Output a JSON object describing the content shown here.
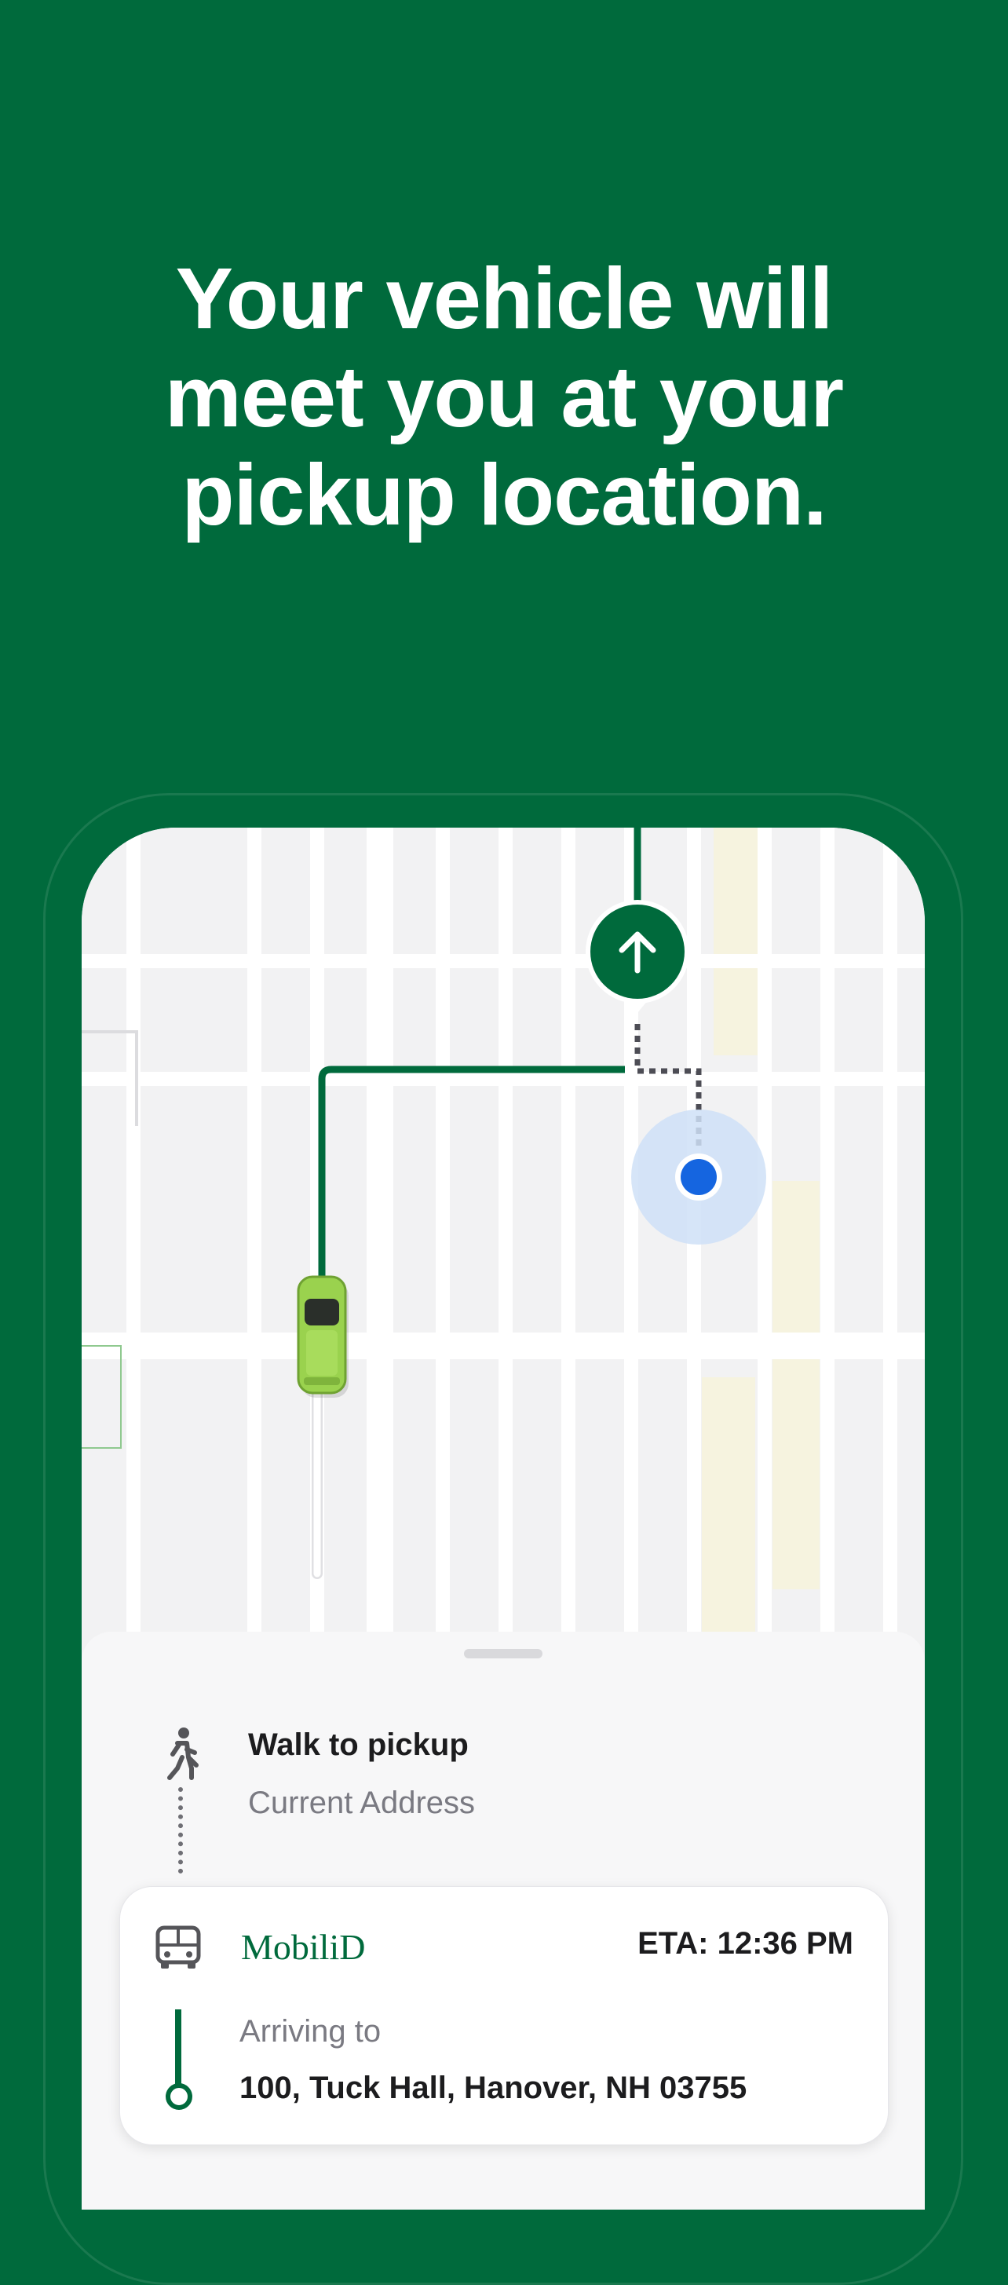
{
  "headline": {
    "line1": "Your vehicle will",
    "line2": "meet you at your",
    "line3": "pickup location."
  },
  "colors": {
    "brand_green": "#006a3c",
    "route_green": "#006a3c",
    "user_location": "#1565e0",
    "vehicle": "#9ad24e"
  },
  "icons": {
    "destination_marker": "arrow-up-icon",
    "walk": "walking-person-icon",
    "vehicle": "van-icon"
  },
  "trip": {
    "walk_title": "Walk to pickup",
    "walk_subtitle": "Current Address",
    "provider": "MobiliD",
    "eta": "ETA: 12:36 PM",
    "arriving_label": "Arriving to",
    "arriving_address": "100, Tuck Hall, Hanover, NH 03755"
  }
}
